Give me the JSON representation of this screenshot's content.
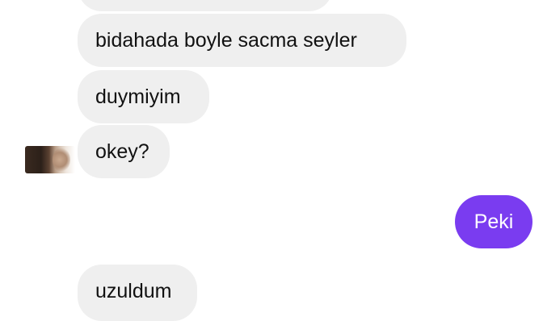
{
  "messages": {
    "incoming": [
      {
        "text": "bidahada boyle sacma seyler"
      },
      {
        "text": "duymiyim"
      },
      {
        "text": "okey?"
      },
      {
        "text": "uzuldum"
      }
    ],
    "outgoing": [
      {
        "text": "Peki"
      }
    ]
  },
  "colors": {
    "incoming_bubble": "#efefef",
    "outgoing_bubble": "#7a3cf0",
    "incoming_text": "#111111",
    "outgoing_text": "#ffffff"
  }
}
